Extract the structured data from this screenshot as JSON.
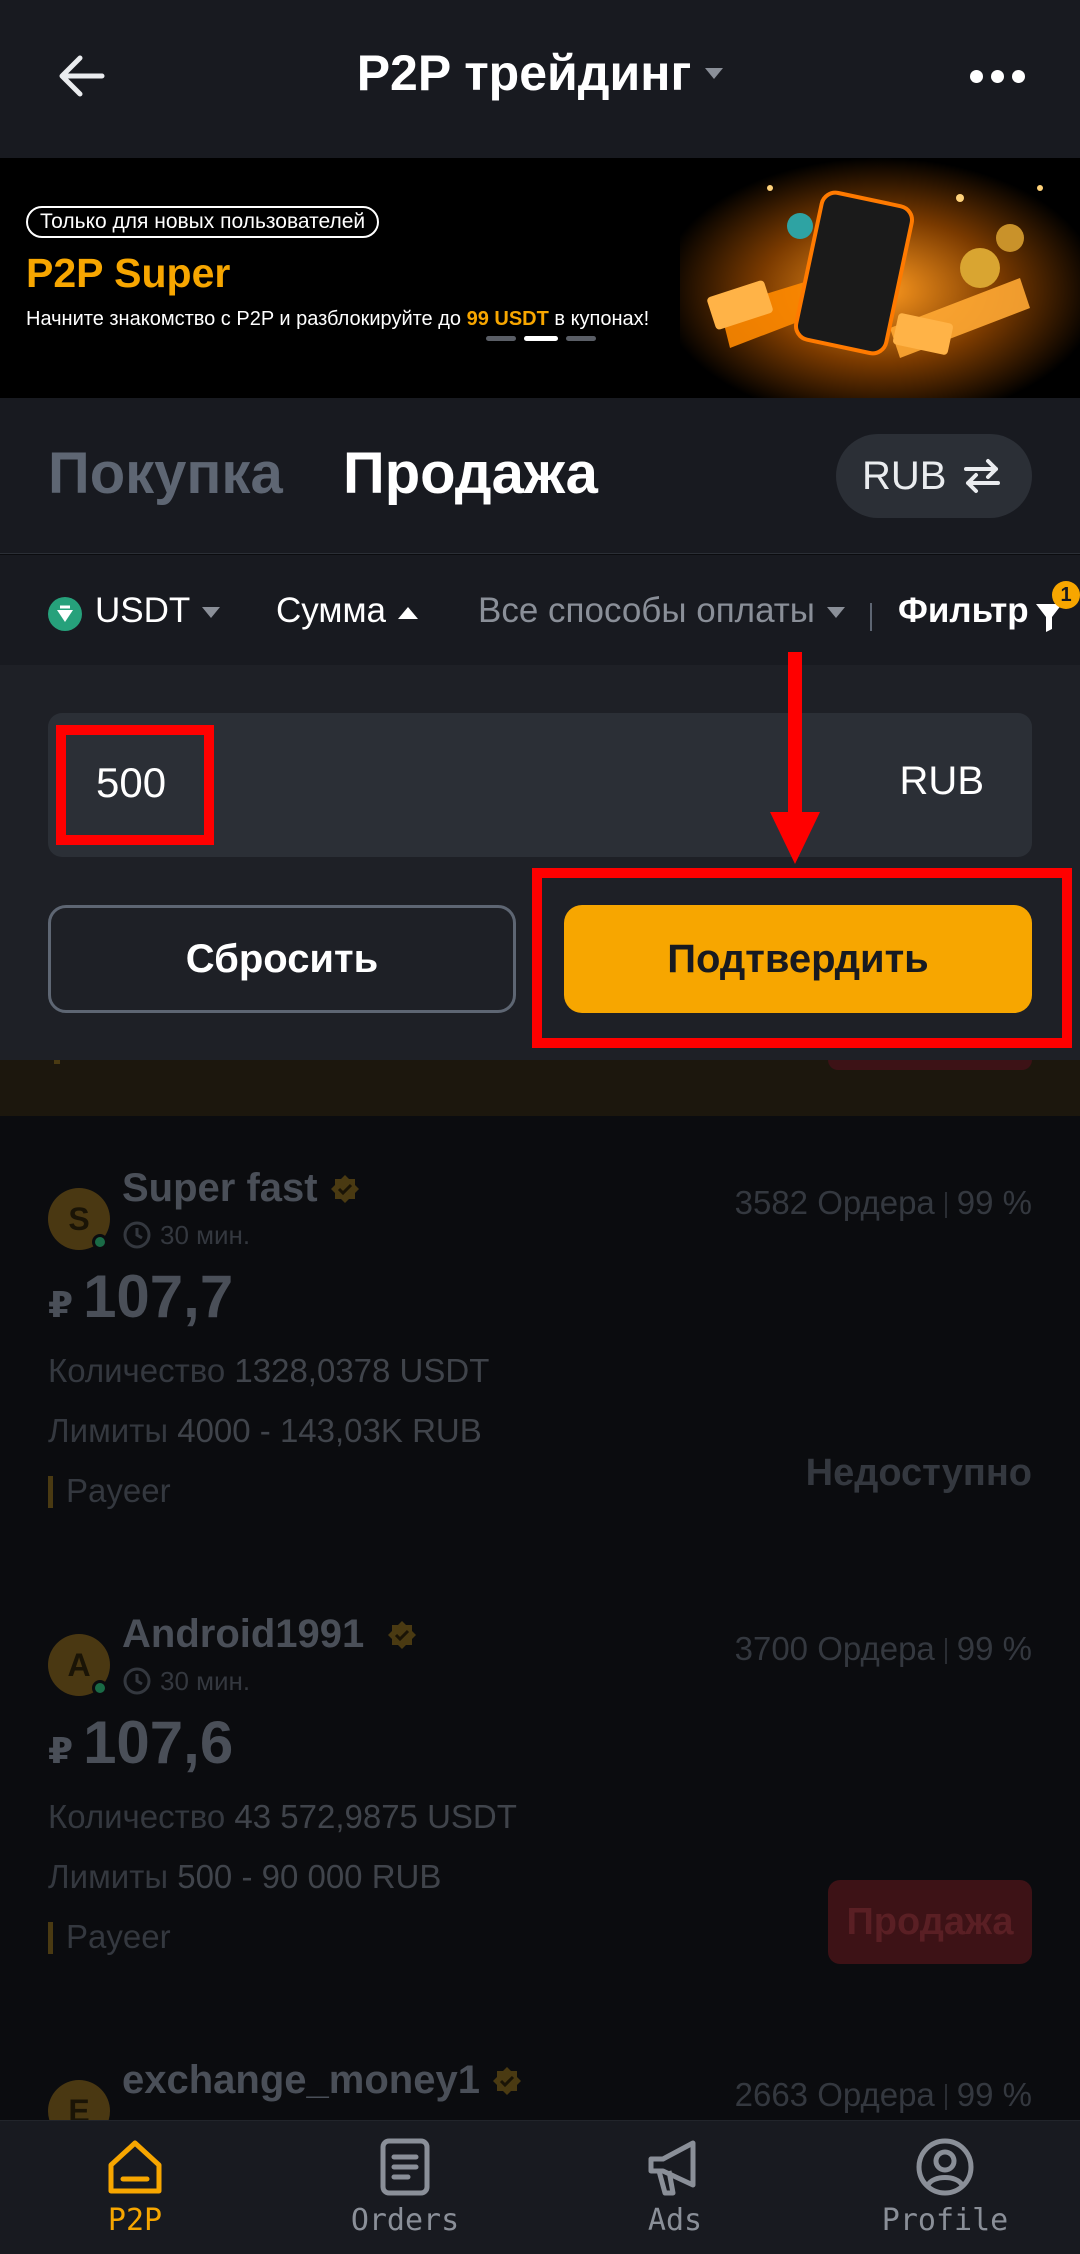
{
  "header": {
    "title": "P2P трейдинг"
  },
  "banner": {
    "chip": "Только для новых пользователей",
    "title": "P2P Super",
    "desc_prefix": "Начните знакомство с P2P и разблокируйте до ",
    "desc_highlight": "99 USDT",
    "desc_suffix": " в купонах!"
  },
  "tabs": {
    "buy": "Покупка",
    "sell": "Продажа",
    "currency": "RUB"
  },
  "filters": {
    "coin": "USDT",
    "amount": "Сумма",
    "payment": "Все способы оплаты",
    "filter": "Фильтр",
    "filter_count": "1"
  },
  "amount_panel": {
    "value": "500",
    "unit": "RUB",
    "reset_label": "Сбросить",
    "confirm_label": "Подтвердить"
  },
  "offers": [
    {
      "initial": "S",
      "name": "Super fast",
      "time": "30 мин.",
      "orders": "3582 Ордера",
      "completion": "99 %",
      "currency_symbol": "₽",
      "price": "107,7",
      "qty_label": "Количество",
      "qty": "1328,0378 USDT",
      "limit_label": "Лимиты",
      "limit": "4000 - 143,03K RUB",
      "payment": "Payeer",
      "action": "Недоступно"
    },
    {
      "initial": "A",
      "name": "Android1991",
      "time": "30 мин.",
      "orders": "3700 Ордера",
      "completion": "99 %",
      "currency_symbol": "₽",
      "price": "107,6",
      "qty_label": "Количество",
      "qty": "43 572,9875 USDT",
      "limit_label": "Лимиты",
      "limit": "500 - 90 000 RUB",
      "payment": "Payeer",
      "action": "Продажа"
    },
    {
      "initial": "E",
      "name": "exchange_money1",
      "orders": "2663 Ордера",
      "completion": "99 %"
    }
  ],
  "bottom_nav": [
    {
      "label": "P2P",
      "icon": "home-icon"
    },
    {
      "label": "Orders",
      "icon": "orders-icon"
    },
    {
      "label": "Ads",
      "icon": "megaphone-icon"
    },
    {
      "label": "Profile",
      "icon": "profile-icon"
    }
  ],
  "colors": {
    "accent": "#f7a600",
    "annotation": "#ff0000",
    "background": "#181a20"
  }
}
